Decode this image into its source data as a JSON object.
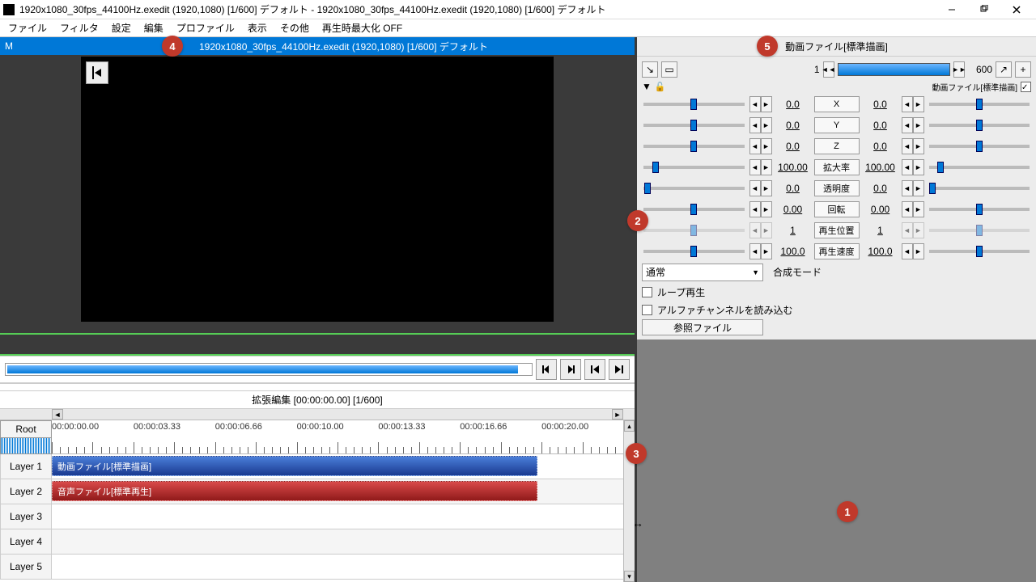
{
  "title": "1920x1080_30fps_44100Hz.exedit (1920,1080)  [1/600]  デフォルト - 1920x1080_30fps_44100Hz.exedit (1920,1080)  [1/600]  デフォルト",
  "menubar": [
    "ファイル",
    "フィルタ",
    "設定",
    "編集",
    "プロファイル",
    "表示",
    "その他",
    "再生時最大化 OFF"
  ],
  "preview_bar": {
    "left": "M",
    "text": "1920x1080_30fps_44100Hz.exedit (1920,1080)  [1/600]  デフォルト"
  },
  "timeline": {
    "title": "拡張編集 [00:00:00.00] [1/600]",
    "root": "Root",
    "layers": [
      "Layer 1",
      "Layer 2",
      "Layer 3",
      "Layer 4",
      "Layer 5"
    ],
    "times": [
      "00:00:00.00",
      "00:00:03.33",
      "00:00:06.66",
      "00:00:10.00",
      "00:00:13.33",
      "00:00:16.66",
      "00:00:20.00"
    ],
    "clip_video": "動画ファイル[標準描画]",
    "clip_audio": "音声ファイル[標準再生]"
  },
  "rp": {
    "title": "動画ファイル[標準描画]",
    "frame_start": "1",
    "frame_end": "600",
    "track_label": "動画ファイル[標準描画]",
    "params": [
      {
        "l": "0.0",
        "name": "X",
        "r": "0.0",
        "lt": 50,
        "rt": 50
      },
      {
        "l": "0.0",
        "name": "Y",
        "r": "0.0",
        "lt": 50,
        "rt": 50
      },
      {
        "l": "0.0",
        "name": "Z",
        "r": "0.0",
        "lt": 50,
        "rt": 50
      },
      {
        "l": "100.00",
        "name": "拡大率",
        "r": "100.00",
        "lt": 12,
        "rt": 12
      },
      {
        "l": "0.0",
        "name": "透明度",
        "r": "0.0",
        "lt": 4,
        "rt": 4
      },
      {
        "l": "0.00",
        "name": "回転",
        "r": "0.00",
        "lt": 50,
        "rt": 50
      },
      {
        "l": "1",
        "name": "再生位置",
        "r": "1",
        "lt": 50,
        "rt": 50,
        "disabled": true
      },
      {
        "l": "100.0",
        "name": "再生速度",
        "r": "100.0",
        "lt": 50,
        "rt": 50
      }
    ],
    "blend_mode": "通常",
    "blend_label": "合成モード",
    "loop": "ループ再生",
    "alpha": "アルファチャンネルを読み込む",
    "ref": "参照ファイル"
  },
  "badges": {
    "1": "1",
    "2": "2",
    "3": "3",
    "4": "4",
    "5": "5"
  }
}
